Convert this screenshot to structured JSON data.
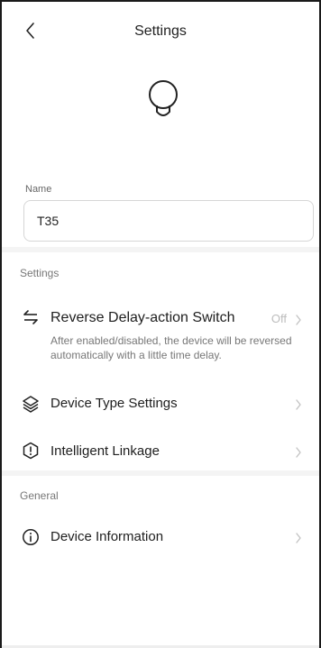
{
  "header": {
    "title": "Settings"
  },
  "device": {
    "name_label": "Name",
    "name_value": "T35"
  },
  "sections": {
    "settings_label": "Settings",
    "general_label": "General"
  },
  "settings_items": [
    {
      "label": "Reverse Delay-action Switch",
      "value": "Off",
      "description": "After enabled/disabled, the device will be reversed automatically with a little time delay.",
      "icon": "swap-arrows-icon"
    },
    {
      "label": "Device Type Settings",
      "icon": "layers-icon"
    },
    {
      "label": "Intelligent Linkage",
      "icon": "hexagon-alert-icon"
    }
  ],
  "general_items": [
    {
      "label": "Device Information",
      "icon": "info-circle-icon"
    }
  ],
  "colors": {
    "accent": "#1e1e1e",
    "muted": "#777777",
    "value": "#bcbcbc",
    "separator": "#f4f4f4",
    "border": "#d6d6d6"
  }
}
